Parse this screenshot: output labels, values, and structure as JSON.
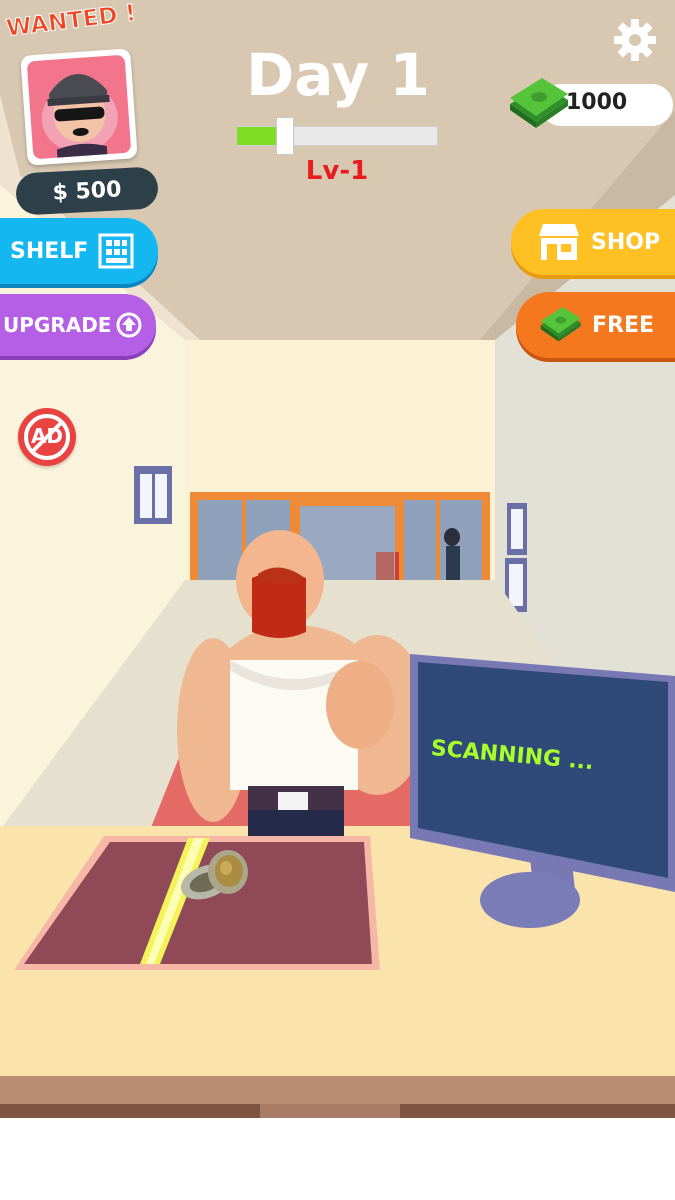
{
  "hud": {
    "wanted_label": "WANTED !",
    "bounty": "$ 500",
    "day_title": "Day 1",
    "level_label": "Lv-1",
    "level_progress": 0.24,
    "cash": "1000"
  },
  "buttons": {
    "shelf": "SHELF",
    "upgrade": "UPGRADE",
    "shop": "SHOP",
    "free": "FREE",
    "no_ads": "AD"
  },
  "monitor": {
    "status": "SCANNING ..."
  },
  "colors": {
    "shelf": "#14b7f0",
    "upgrade": "#b55ee6",
    "shop": "#ffc024",
    "free": "#f5781f",
    "progress": "#7fdd23",
    "level_text": "#e81c1c"
  }
}
